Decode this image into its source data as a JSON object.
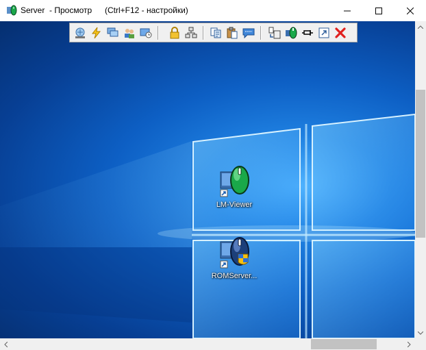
{
  "window": {
    "title": "Server  - Просмотр",
    "hint": "(Ctrl+F12 - настройки)"
  },
  "toolbar": {
    "buttons": [
      {
        "icon": "ctrl-alt-del-icon"
      },
      {
        "icon": "lightning-icon"
      },
      {
        "icon": "windows-icon"
      },
      {
        "icon": "users-icon"
      },
      {
        "icon": "screen-icon"
      },
      {
        "icon": "lock-icon"
      },
      {
        "icon": "network-icon"
      },
      {
        "icon": "copy-icon"
      },
      {
        "icon": "paste-icon"
      },
      {
        "icon": "chat-icon"
      },
      {
        "icon": "file-transfer-icon"
      },
      {
        "icon": "lm-viewer-icon"
      },
      {
        "icon": "pin-icon"
      },
      {
        "icon": "fullscreen-icon"
      },
      {
        "icon": "close-connection-icon"
      }
    ]
  },
  "desktop": {
    "icons": [
      {
        "label": "LM-Viewer"
      },
      {
        "label": "ROMServer..."
      }
    ]
  },
  "colors": {
    "desktop": "#0d5fc4",
    "accent_red": "#e0201e",
    "lm_green": "#1aa84a"
  }
}
